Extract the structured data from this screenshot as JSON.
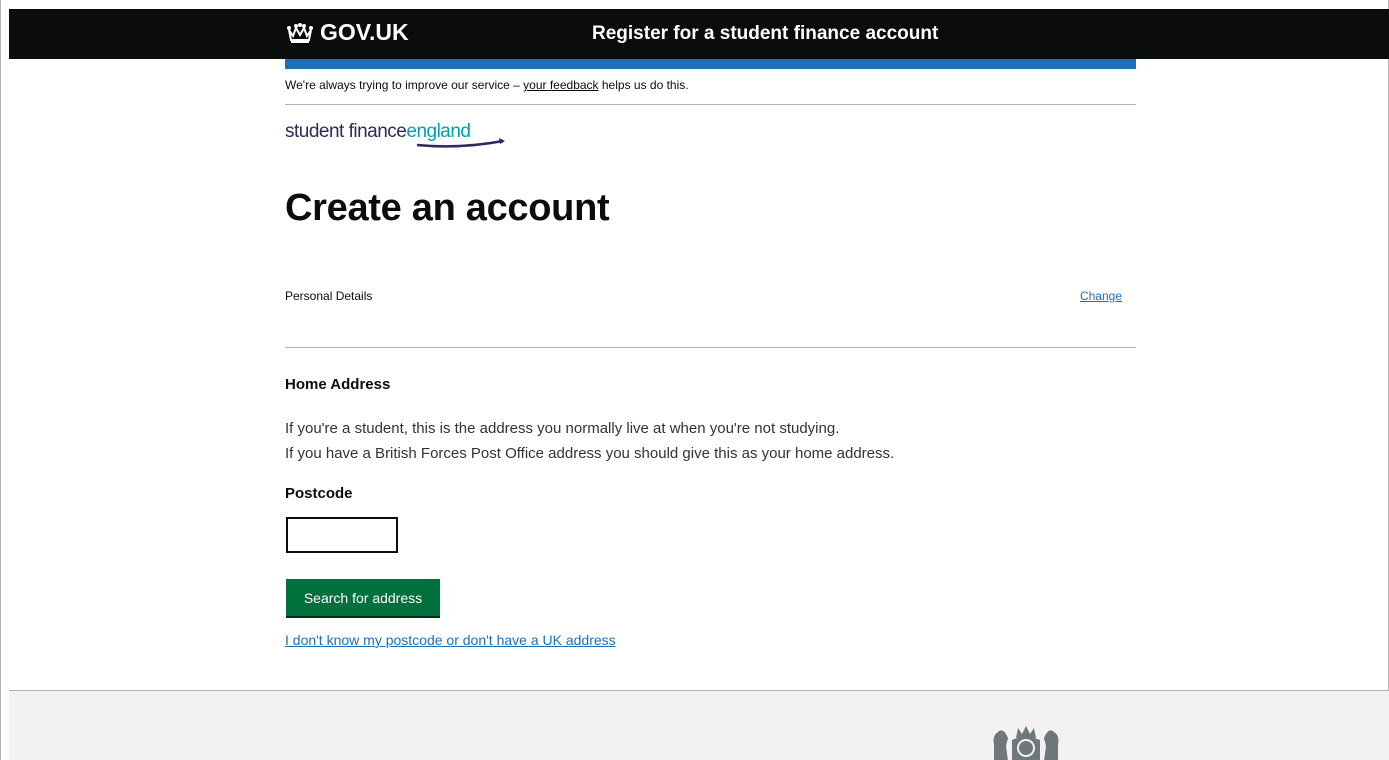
{
  "header": {
    "logo_text": "GOV.UK",
    "crown_icon": "crown-icon",
    "service_name": "Register for a student finance account"
  },
  "feedback_banner": {
    "text_before": "We're always trying to improve our service – ",
    "link_text": "your feedback",
    "text_after": " helps us do this."
  },
  "brand": {
    "word1": "student finance",
    "word2": "england"
  },
  "page_title": "Create an account",
  "summary": {
    "key": "Personal Details",
    "action": "Change"
  },
  "address": {
    "heading": "Home Address",
    "hint_line1": "If you're a student, this is the address you normally live at when you're not studying.",
    "hint_line2": "If you have a British Forces Post Office address you should give this as your home address.",
    "postcode_label": "Postcode",
    "postcode_value": "",
    "search_button": "Search for address",
    "no_postcode_link": "I don't know my postcode or don't have a UK address"
  },
  "colors": {
    "header_bg": "#0b0c0c",
    "blue_bar": "#1d70b8",
    "link": "#1d70b8",
    "button_green": "#00703c",
    "footer_bg": "#f3f2f1"
  }
}
